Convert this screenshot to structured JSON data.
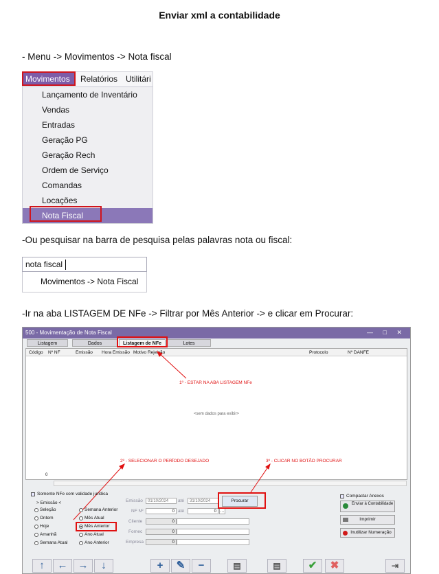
{
  "title": "Enviar xml a contabilidade",
  "step1": "- Menu -> Movimentos -> Nota fiscal",
  "menu": {
    "bar": [
      "Movimentos",
      "Relatórios",
      "Utilitári"
    ],
    "items": [
      "Lançamento de Inventário",
      "Vendas",
      "Entradas",
      "Geração PG",
      "Geração Rech",
      "Ordem de Serviço",
      "Comandas",
      "Locações",
      "Nota Fiscal"
    ]
  },
  "step2": "-Ou pesquisar na barra de pesquisa pelas palavras nota ou fiscal:",
  "search": {
    "value": "nota fiscal",
    "suggestion": "Movimentos -> Nota Fiscal"
  },
  "step3": "-Ir na aba LISTAGEM DE NFe -> Filtrar por Mês Anterior -> e clicar em Procurar:",
  "app": {
    "title": "500 - Movimentação de Nota Fiscal",
    "window_controls": "— □ ✕",
    "tabs": [
      "Listagem",
      "Dados",
      "Listagem de NFe",
      "Lotes"
    ],
    "columns": [
      "Código",
      "Nº NF",
      "Emissão",
      "Hora Emissão",
      "Motivo Rejeição",
      "Protocolo",
      "Nº DANFE"
    ],
    "empty_text": "<sem dados para exibir>",
    "row_count": "0",
    "annotations": {
      "a1": "1º - ESTAR NA ABA LISTAGEM NFe",
      "a2": "2º - SELECIONAR O PERÍODO DESEJADO",
      "a3": "3º - CLICAR NO BOTÃO PROCURAR"
    },
    "only_valid": "Somente NFe com validade jurídica",
    "emissao_group": "> Emissão <",
    "periods_left": [
      "Seleção",
      "Ontem",
      "Hoje",
      "Amanhã",
      "Semana Atual"
    ],
    "periods_right": [
      "Semana Anterior",
      "Mês Atual",
      "Mês Anterior",
      "Ano Atual",
      "Ano Anterior"
    ],
    "selected_period": "Mês Anterior",
    "filters": {
      "emissao_label": "Emissão",
      "from": "01/10/2024",
      "ate": "até",
      "to": "31/10/2024",
      "nf_label": "NF Nº",
      "nf_from": "0",
      "nf_to": "0",
      "cliente": "Cliente",
      "cliente_val": "0",
      "fornec": "Fornec",
      "fornec_val": "0",
      "empresa": "Empresa",
      "empresa_val": "0"
    },
    "search_button": "Procurar",
    "compactar": "Compactar Anexos",
    "send_button": "Enviar à Contabilidade",
    "print_button": "Imprimir",
    "invalidate_button": "Inutilizar Numeração",
    "toolbar_icons": [
      "arrow-up-icon",
      "arrow-left-icon",
      "arrow-right-icon",
      "arrow-down-icon",
      "plus-icon",
      "pencil-icon",
      "minus-icon",
      "doc-icon",
      "doc-search-icon",
      "check-icon",
      "close-icon",
      "exit-icon"
    ]
  }
}
